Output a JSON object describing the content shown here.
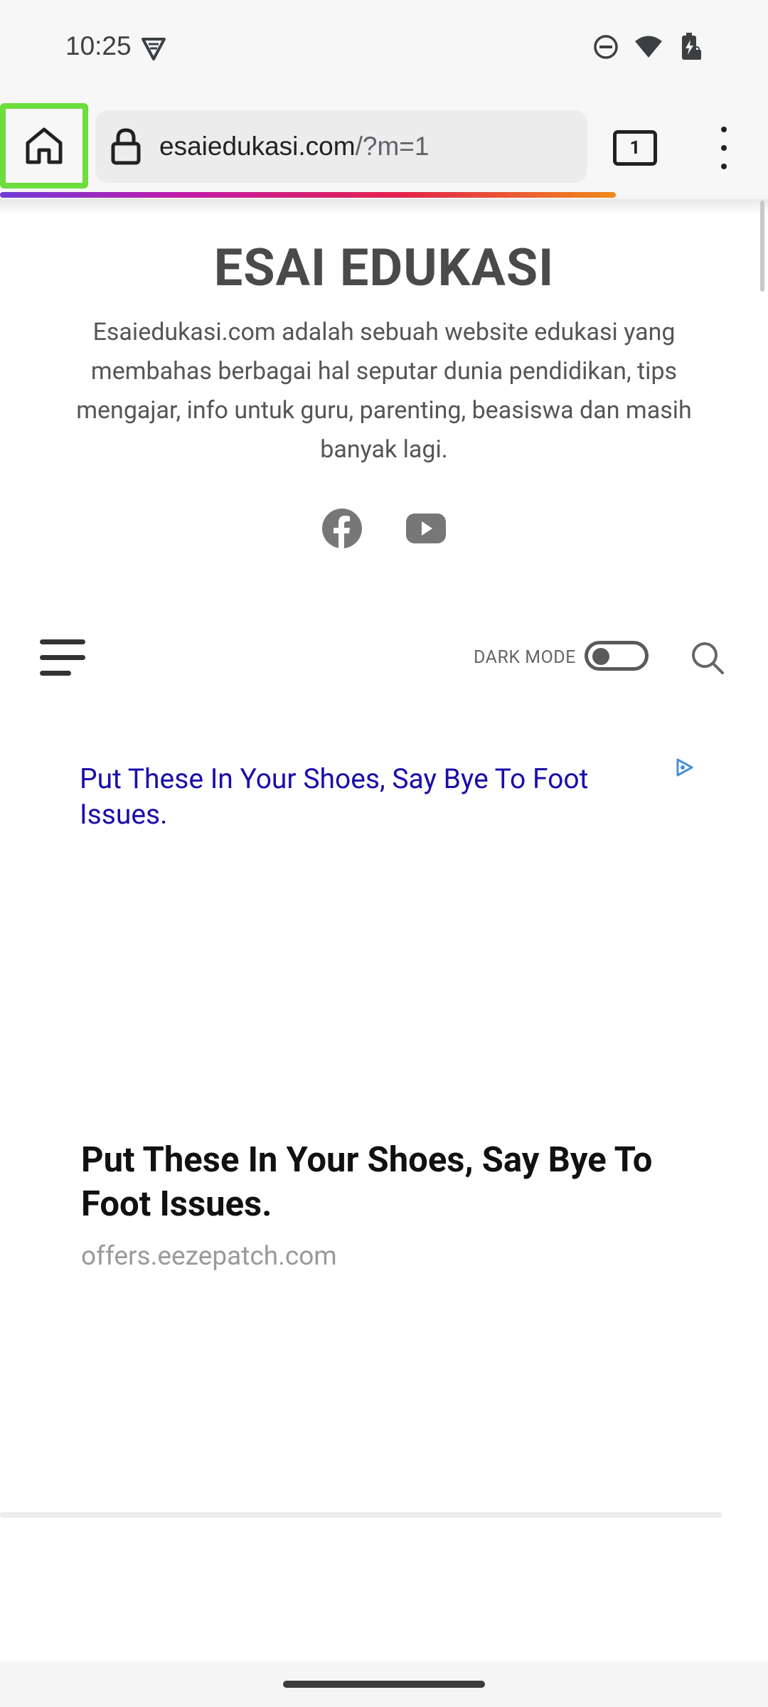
{
  "status_bar": {
    "time": "10:25",
    "icons": [
      "vpn-icon",
      "do-not-disturb-icon",
      "wifi-icon",
      "battery-icon"
    ]
  },
  "browser": {
    "url_domain": "esaiedukasi.com",
    "url_path": "/?m=1",
    "tab_count": "1",
    "home_highlight_color": "#6ddc3d"
  },
  "site": {
    "title": "ESAI EDUKASI",
    "description": "Esaiedukasi.com adalah sebuah website edukasi yang membahas berbagai hal seputar dunia pendidikan, tips mengajar, info untuk guru, parenting, beasiswa dan masih banyak lagi.",
    "social_icons": [
      "facebook-icon",
      "youtube-icon"
    ]
  },
  "nav": {
    "dark_mode_label": "DARK MODE",
    "dark_mode_on": false
  },
  "ad": {
    "link_text": "Put These In Your Shoes, Say Bye To Foot Issues.",
    "headline": "Put These In Your Shoes, Say Bye To Foot Issues.",
    "domain": "offers.eezepatch.com",
    "link_color": "#1a0dab"
  }
}
